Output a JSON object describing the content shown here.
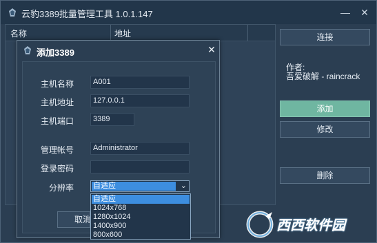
{
  "window": {
    "title": "云豹3389批量管理工具 1.0.1.147",
    "minimize": "—",
    "close": "✕"
  },
  "list": {
    "columns": [
      "名称",
      "地址"
    ]
  },
  "right_panel": {
    "connect": "连接",
    "author_label": "作者:",
    "author_name": "吾爱破解 - raincrack",
    "add": "添加",
    "edit": "修改",
    "delete": "删除"
  },
  "dialog": {
    "title": "添加3389",
    "close": "✕",
    "fields": {
      "host_name_label": "主机名称",
      "host_name_value": "A001",
      "host_addr_label": "主机地址",
      "host_addr_value": "127.0.0.1",
      "host_port_label": "主机端口",
      "host_port_value": "3389",
      "account_label": "管理帐号",
      "account_value": "Administrator",
      "password_label": "登录密码",
      "password_value": "",
      "resolution_label": "分辨率",
      "resolution_value": "自适应"
    },
    "resolution_options": [
      "自适应",
      "1024x768",
      "1280x1024",
      "1400x900",
      "800x600"
    ],
    "selected_index": 0,
    "cancel_visible": "取消"
  },
  "colors": {
    "background": "#2b3e52",
    "accent": "#6fb6a1",
    "selection": "#3d8ee0"
  }
}
